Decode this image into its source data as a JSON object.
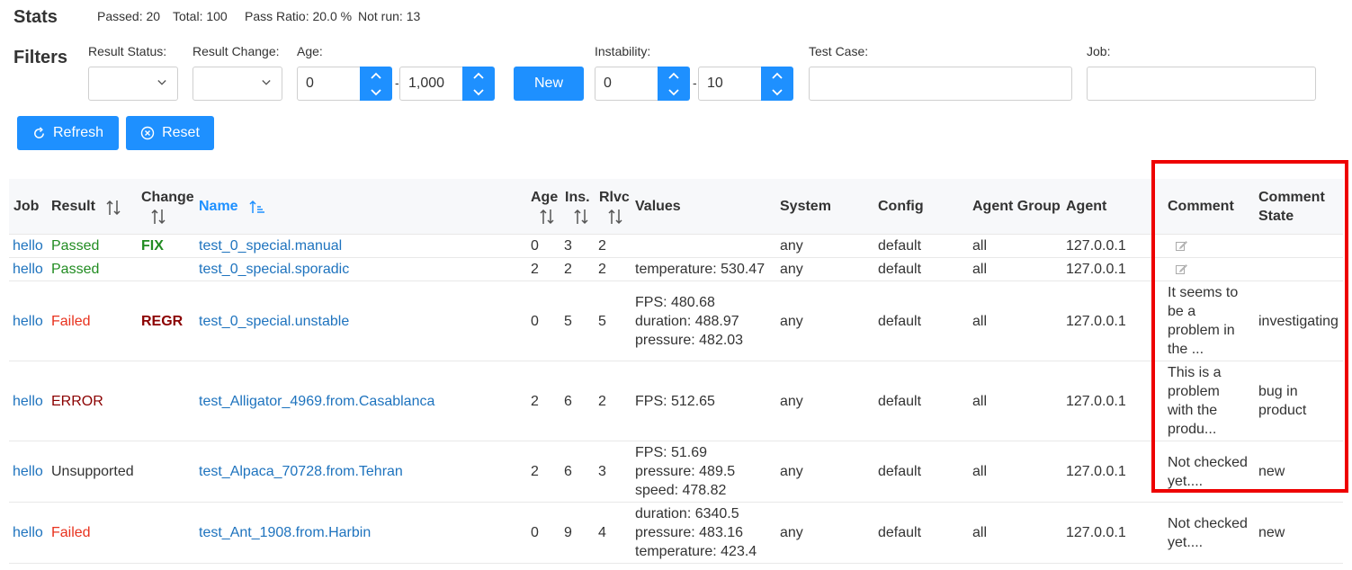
{
  "stats": {
    "title": "Stats",
    "passed": "Passed: 20",
    "total": "Total: 100",
    "pass_ratio": "Pass Ratio: 20.0 %",
    "not_run": "Not run: 13"
  },
  "filters": {
    "title": "Filters",
    "result_status_label": "Result Status:",
    "result_change_label": "Result Change:",
    "age_label": "Age:",
    "age_min": "0",
    "age_max": "1,000",
    "new_button": "New",
    "instability_label": "Instability:",
    "inst_min": "0",
    "inst_max": "10",
    "test_case_label": "Test Case:",
    "job_label": "Job:",
    "range_sep": "-"
  },
  "actions": {
    "refresh": "Refresh",
    "reset": "Reset"
  },
  "table": {
    "headers": {
      "job": "Job",
      "result": "Result",
      "change": "Change",
      "name": "Name",
      "age": "Age",
      "ins": "Ins.",
      "rlvc": "Rlvc",
      "values": "Values",
      "system": "System",
      "config": "Config",
      "agent_group": "Agent Group",
      "agent": "Agent",
      "comment": "Comment",
      "comment_state_1": "Comment",
      "comment_state_2": "State"
    },
    "rows": [
      {
        "job": "hello",
        "result": "Passed",
        "change": "FIX",
        "name": "test_0_special.manual",
        "age": "0",
        "ins": "3",
        "rlvc": "2",
        "values": [],
        "system": "any",
        "config": "default",
        "agent_group": "all",
        "agent": "127.0.0.1",
        "comment": [],
        "comment_state": "",
        "comment_icon": "edit-icon"
      },
      {
        "job": "hello",
        "result": "Passed",
        "change": "",
        "name": "test_0_special.sporadic",
        "age": "2",
        "ins": "2",
        "rlvc": "2",
        "values": [
          "temperature: 530.47"
        ],
        "system": "any",
        "config": "default",
        "agent_group": "all",
        "agent": "127.0.0.1",
        "comment": [],
        "comment_state": "",
        "comment_icon": "edit-icon"
      },
      {
        "job": "hello",
        "result": "Failed",
        "change": "REGR",
        "name": "test_0_special.unstable",
        "age": "0",
        "ins": "5",
        "rlvc": "5",
        "values": [
          "FPS: 480.68",
          "duration: 488.97",
          "pressure: 482.03"
        ],
        "system": "any",
        "config": "default",
        "agent_group": "all",
        "agent": "127.0.0.1",
        "comment": [
          "It seems to",
          "be a",
          "problem in",
          "the ..."
        ],
        "comment_state": "investigating"
      },
      {
        "job": "hello",
        "result": "ERROR",
        "change": "",
        "name": "test_Alligator_4969.from.Casablanca",
        "age": "2",
        "ins": "6",
        "rlvc": "2",
        "values": [
          "FPS: 512.65"
        ],
        "system": "any",
        "config": "default",
        "agent_group": "all",
        "agent": "127.0.0.1",
        "comment": [
          "This is a",
          "problem",
          "with the",
          "produ..."
        ],
        "comment_state": "bug in product"
      },
      {
        "job": "hello",
        "result": "Unsupported",
        "change": "",
        "name": "test_Alpaca_70728.from.Tehran",
        "age": "2",
        "ins": "6",
        "rlvc": "3",
        "values": [
          "FPS: 51.69",
          "pressure: 489.5",
          "speed: 478.82"
        ],
        "system": "any",
        "config": "default",
        "agent_group": "all",
        "agent": "127.0.0.1",
        "comment": [
          "Not checked",
          "yet...."
        ],
        "comment_state": "new"
      },
      {
        "job": "hello",
        "result": "Failed",
        "change": "",
        "name": "test_Ant_1908.from.Harbin",
        "age": "0",
        "ins": "9",
        "rlvc": "4",
        "values": [
          "duration: 6340.5",
          "pressure: 483.16",
          "temperature: 423.4"
        ],
        "system": "any",
        "config": "default",
        "agent_group": "all",
        "agent": "127.0.0.1",
        "comment": [
          "Not checked",
          "yet...."
        ],
        "comment_state": "new"
      }
    ]
  },
  "colors": {
    "accent": "#1e90ff",
    "passed": "#218c21",
    "failed": "#e8321e",
    "error": "#8b0000",
    "highlight_box": "#ee0000"
  }
}
